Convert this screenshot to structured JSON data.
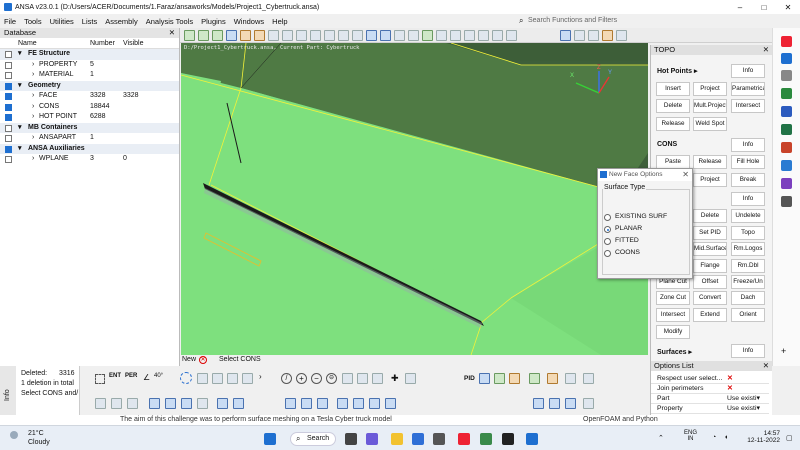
{
  "window": {
    "title": "ANSA v23.0.1 (D:/Users/ACER/Documents/1.Faraz/ansaworks/Models/Project1_Cybertruck.ansa)",
    "min": "–",
    "max": "□",
    "close": "✕"
  },
  "menu": [
    "File",
    "Tools",
    "Utilities",
    "Lists",
    "Assembly",
    "Analysis Tools",
    "Plugins",
    "Windows",
    "Help"
  ],
  "search": {
    "placeholder": "Search Functions and Filters"
  },
  "database": {
    "title": "Database",
    "columns": {
      "name": "Name",
      "number": "Number",
      "visible": "Visible"
    },
    "rows": [
      {
        "type": "section",
        "name": "FE Structure",
        "checked": false
      },
      {
        "type": "item",
        "name": "PROPERTY",
        "number": "5",
        "visible": ""
      },
      {
        "type": "item",
        "name": "MATERIAL",
        "number": "1",
        "visible": ""
      },
      {
        "type": "section",
        "name": "Geometry",
        "checked": true
      },
      {
        "type": "item",
        "name": "FACE",
        "number": "3328",
        "visible": "3328",
        "checked": true
      },
      {
        "type": "item",
        "name": "CONS",
        "number": "18844",
        "visible": "",
        "checked": true
      },
      {
        "type": "item",
        "name": "HOT POINT",
        "number": "6288",
        "visible": "",
        "checked": true
      },
      {
        "type": "section",
        "name": "MB Containers",
        "checked": false
      },
      {
        "type": "item",
        "name": "ANSAPART",
        "number": "1",
        "visible": ""
      },
      {
        "type": "section",
        "name": "ANSA Auxiliaries",
        "checked": true
      },
      {
        "type": "item",
        "name": "WPLANE",
        "number": "3",
        "visible": "0",
        "checked": false
      }
    ]
  },
  "viewport": {
    "info": "D:/Project1_Cybertruck.ansa, Current Part: Cybertruck",
    "axes": {
      "x": "X",
      "y": "Y",
      "z": "Z"
    }
  },
  "topo": {
    "title": "TOPO",
    "sections": {
      "hotpoints": "Hot Points ▸",
      "cons": "CONS",
      "surfaces": "Surfaces ▸"
    },
    "buttons": {
      "info1": "Info",
      "insert": "Insert",
      "project1": "Project",
      "parametrical": "Parametrical",
      "delete1": "Delete",
      "multproject": "Mult.Project",
      "intersect1": "Intersect",
      "release1": "Release",
      "weldspot": "Weld Spot",
      "info2": "Info",
      "paste": "Paste",
      "release2": "Release",
      "fillhole": "Fill Hole",
      "project2": "Project",
      "break": "Break",
      "info3": "Info",
      "delete2": "Delete",
      "undelete": "Undelete",
      "setpid": "Set PID",
      "topo": "Topo",
      "midsurface": "Mid.Surface",
      "rmlogos": "Rm.Logos",
      "flange": "Flange",
      "rmdbl": "Rm.Dbl",
      "planecut": "Plane Cut",
      "offset": "Offset",
      "freezeun": "Freeze/Un",
      "zonecut": "Zone Cut",
      "convert": "Convert",
      "dach": "Dach",
      "intersect2": "Intersect",
      "extend": "Extend",
      "orient": "Orient",
      "modify": "Modify",
      "info4": "Info"
    }
  },
  "dialog": {
    "title": "New Face Options",
    "close": "✕",
    "group": "Surface Type",
    "options": [
      "EXISTING SURF",
      "PLANAR",
      "FITTED",
      "COONS"
    ],
    "selected": "PLANAR"
  },
  "statusbar": {
    "new": "New",
    "select": "Select CONS"
  },
  "info": {
    "tab": "Info",
    "deleted_label": "Deleted:",
    "deleted_value": "3316",
    "line2": "1 deletion in total",
    "line3": "Select CONS and/"
  },
  "toolbar_bottom": {
    "ent": "ENT",
    "per": "PER",
    "angle": "40°",
    "pid": "PID"
  },
  "options_list": {
    "title": "Options List",
    "rows": [
      {
        "key": "Respect user select...",
        "value": "✕",
        "red": true
      },
      {
        "key": "Join perimeters",
        "value": "✕",
        "red": true
      },
      {
        "key": "Part",
        "value": "Use existi▾",
        "red": false
      },
      {
        "key": "Property",
        "value": "Use existi▾",
        "red": false
      }
    ]
  },
  "background_strip": {
    "left": "The aim of this challenge was to perform surface meshing on a Tesla Cyber truck model",
    "right": "OpenFOAM and Python"
  },
  "taskbar": {
    "temp": "21°C",
    "weather": "Cloudy",
    "search": "Search",
    "lang1": "ENG",
    "lang2": "IN",
    "time": "14:57",
    "date": "12-11-2022"
  },
  "colors": {
    "face": "#7ee07e",
    "face_dark": "#3e5f3a",
    "edge_yellow": "#f2f23a",
    "edge_black": "#1a1a1a",
    "accent": "#1e6fd0"
  }
}
